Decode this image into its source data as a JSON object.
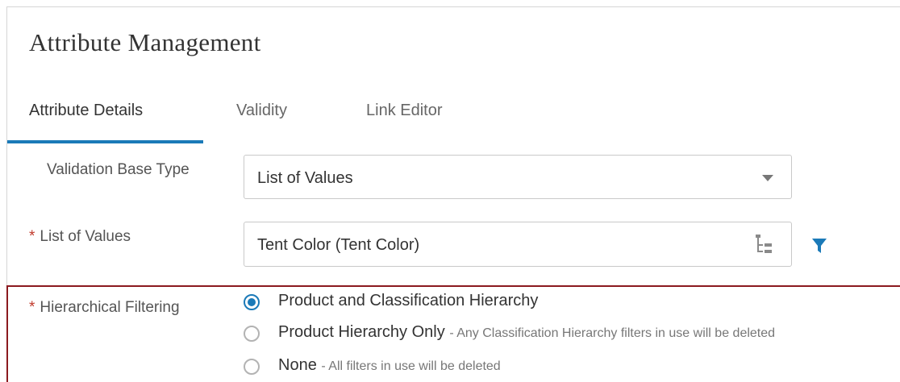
{
  "page": {
    "title": "Attribute Management"
  },
  "tabs": [
    {
      "label": "Attribute Details",
      "active": true
    },
    {
      "label": "Validity",
      "active": false
    },
    {
      "label": "Link Editor",
      "active": false
    }
  ],
  "form": {
    "validation_base_type": {
      "label": "Validation Base Type",
      "value": "List of Values"
    },
    "list_of_values": {
      "required_mark": "*",
      "label": "List of Values",
      "value": "Tent Color (Tent Color)"
    },
    "hierarchical_filtering": {
      "required_mark": "*",
      "label": "Hierarchical Filtering",
      "options": [
        {
          "label": "Product and Classification Hierarchy",
          "desc": "",
          "checked": true
        },
        {
          "label": "Product Hierarchy Only",
          "desc": "- Any Classification Hierarchy filters in use will be deleted",
          "checked": false
        },
        {
          "label": "None",
          "desc": "- All filters in use will be deleted",
          "checked": false
        }
      ]
    }
  },
  "colors": {
    "accent": "#1b7ab8",
    "required": "#c0392b",
    "highlight_border": "#8b1a1f"
  },
  "icons": {
    "dropdown": "chevron-down-icon",
    "tree": "tree-picker-icon",
    "filter": "filter-icon"
  }
}
